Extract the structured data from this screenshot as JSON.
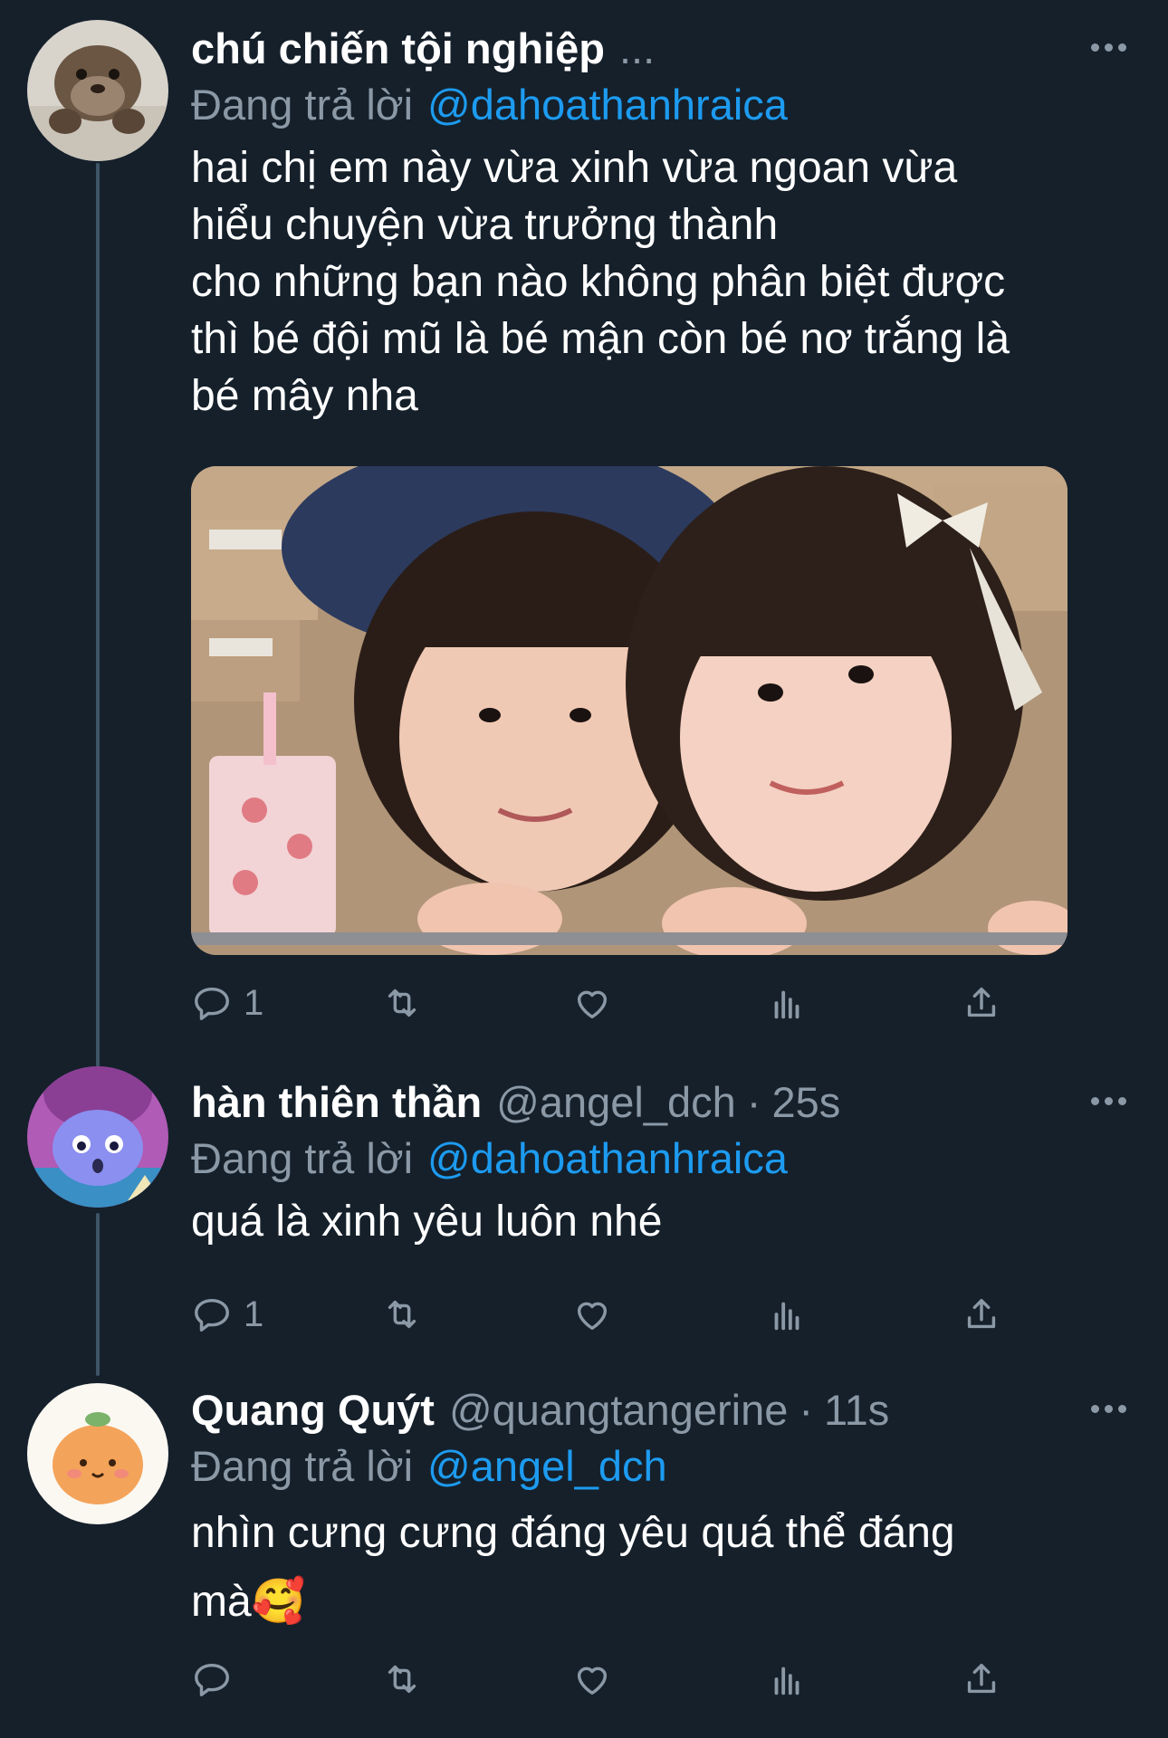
{
  "tweets": [
    {
      "display_name": "chú chiến tội nghiệp",
      "name_suffix": "...",
      "reply_prefix": "Đang trả lời",
      "reply_to": "@dahoathanhraica",
      "lines": [
        "hai chị em này vừa xinh vừa ngoan vừa",
        "hiểu chuyện vừa trưởng thành",
        "cho những bạn nào không phân biệt được",
        "thì bé đội mũ là bé mận còn bé nơ trắng là",
        "bé mây nha"
      ],
      "has_media": true,
      "reply_count": "1",
      "avatar_icon": "otter-avatar"
    },
    {
      "display_name": "hàn thiên thần",
      "handle": "@angel_dch",
      "separator": "·",
      "time": "25s",
      "reply_prefix": "Đang trả lời",
      "reply_to": "@dahoathanhraica",
      "lines": [
        "quá là xinh yêu luôn nhé"
      ],
      "reply_count": "1",
      "avatar_icon": "purple-cartoon-avatar"
    },
    {
      "display_name": "Quang Quýt",
      "handle": "@quangtangerine",
      "separator": "·",
      "time": "11s",
      "reply_prefix": "Đang trả lời",
      "reply_to": "@angel_dch",
      "lines": [
        "nhìn cưng cưng đáng yêu quá thể đáng",
        "mà🥰"
      ],
      "reply_count": "",
      "avatar_icon": "tangerine-avatar"
    }
  ],
  "colors": {
    "background": "#15202b",
    "text": "#ffffff",
    "secondary": "#8b98a5",
    "accent": "#1d9bf0",
    "thread_line": "#3d5466"
  },
  "icons": {
    "reply": "reply-icon",
    "retweet": "retweet-icon",
    "like": "heart-icon",
    "analytics": "analytics-icon",
    "share": "share-icon",
    "more": "more-icon"
  }
}
